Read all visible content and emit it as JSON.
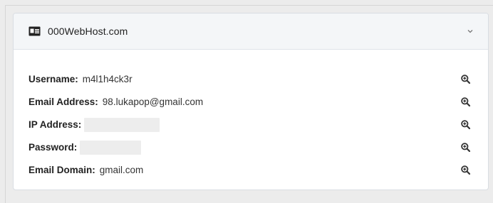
{
  "card": {
    "title": "000WebHost.com",
    "header_icon": "id-card-icon",
    "toggle_icon": "chevron-down-icon"
  },
  "fields": [
    {
      "label": "Username:",
      "value": "m4l1h4ck3r",
      "redacted": false,
      "action_icon": "zoom-in-icon"
    },
    {
      "label": "Email Address:",
      "value": "98.lukapop@gmail.com",
      "redacted": false,
      "action_icon": "zoom-in-icon"
    },
    {
      "label": "IP Address:",
      "value": "",
      "redacted": true,
      "action_icon": "zoom-in-icon"
    },
    {
      "label": "Password:",
      "value": "",
      "redacted": true,
      "action_icon": "zoom-in-icon"
    },
    {
      "label": "Email Domain:",
      "value": "gmail.com",
      "redacted": false,
      "action_icon": "zoom-in-icon"
    }
  ]
}
